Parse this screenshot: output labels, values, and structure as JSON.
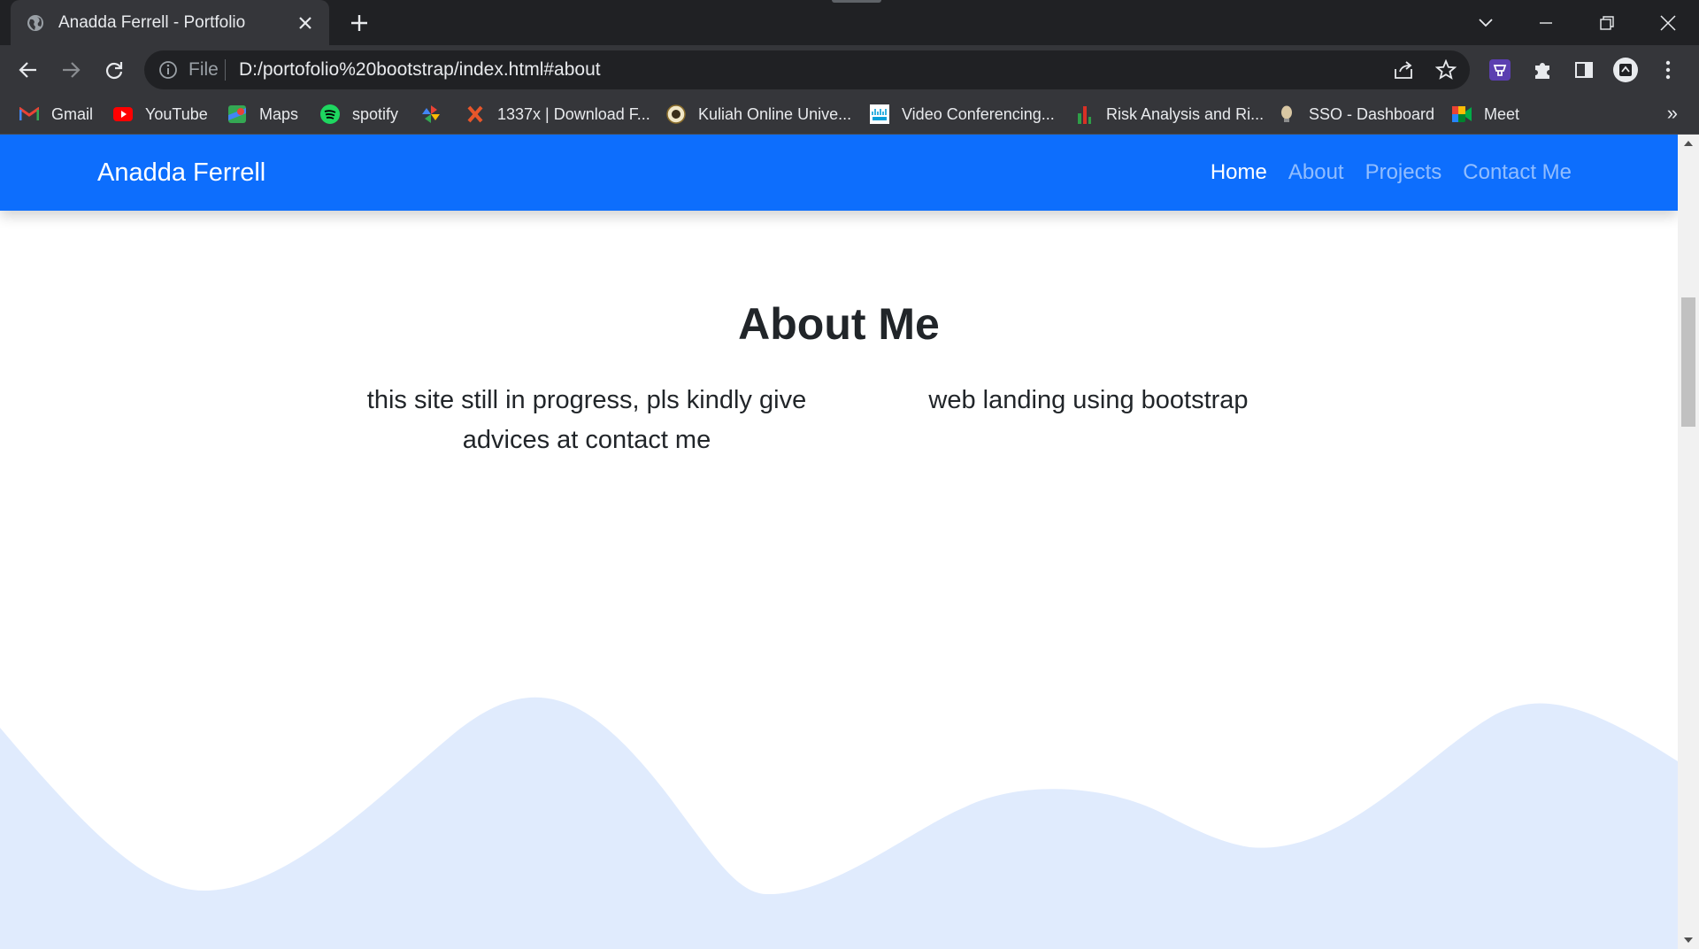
{
  "browser": {
    "tab": {
      "title": "Anadda Ferrell - Portfolio"
    },
    "omnibox": {
      "scheme": "File",
      "url": "D:/portofolio%20bootstrap/index.html#about"
    },
    "bookmarks": [
      {
        "label": "Gmail",
        "icon": "gmail-icon"
      },
      {
        "label": "YouTube",
        "icon": "youtube-icon"
      },
      {
        "label": "Maps",
        "icon": "maps-icon"
      },
      {
        "label": "spotify",
        "icon": "spotify-icon"
      },
      {
        "label": "",
        "icon": "pinwheel-icon"
      },
      {
        "label": "1337x | Download F...",
        "icon": "1337x-icon"
      },
      {
        "label": "Kuliah Online Unive...",
        "icon": "university-seal-icon"
      },
      {
        "label": "Video Conferencing...",
        "icon": "cisco-icon"
      },
      {
        "label": "Risk Analysis and Ri...",
        "icon": "chart-bars-icon"
      },
      {
        "label": "SSO - Dashboard",
        "icon": "bulb-icon"
      },
      {
        "label": "Meet",
        "icon": "meet-icon"
      }
    ],
    "more": "»"
  },
  "site": {
    "brand": "Anadda Ferrell",
    "nav": [
      {
        "label": "Home",
        "active": true
      },
      {
        "label": "About",
        "active": false
      },
      {
        "label": "Projects",
        "active": false
      },
      {
        "label": "Contact Me",
        "active": false
      }
    ],
    "about": {
      "title": "About Me",
      "left_text": "this site still in progress, pls kindly give advices at contact me",
      "right_text": "web landing using bootstrap"
    }
  },
  "colors": {
    "chrome_dark": "#202124",
    "chrome_toolbar": "#35363a",
    "navbar": "#0d6efd",
    "wave": "#e0ebfd",
    "text": "#212529"
  }
}
